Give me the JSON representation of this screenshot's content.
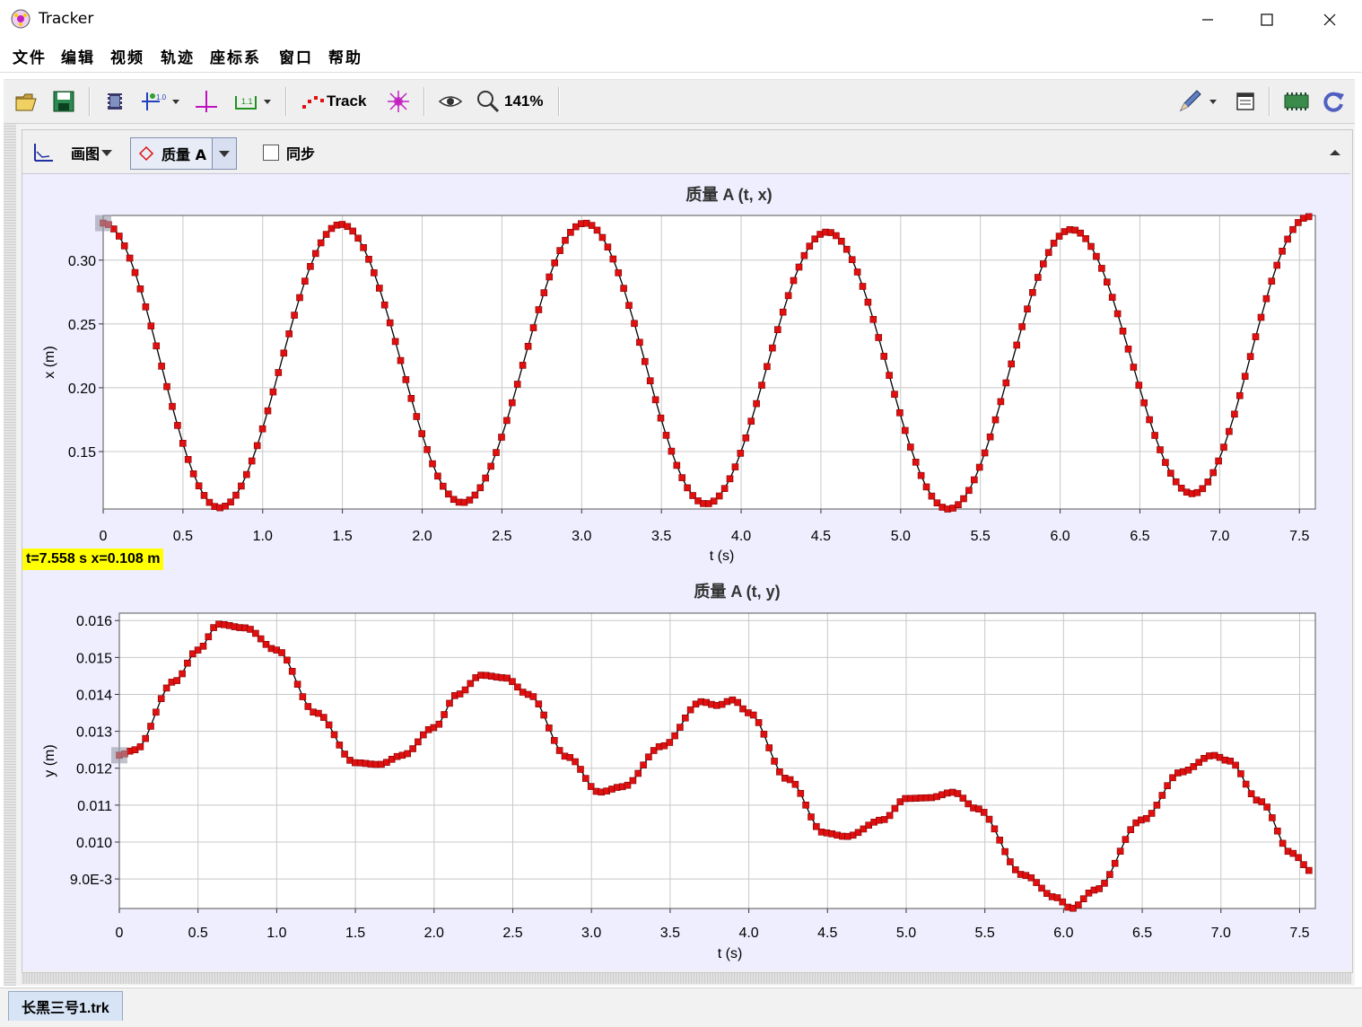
{
  "window": {
    "title": "Tracker"
  },
  "menu": [
    "文件",
    "编辑",
    "视频",
    "轨迹",
    "座标系",
    "窗口",
    "帮助"
  ],
  "toolbar": {
    "track_label": "Track",
    "zoom_label": "141%"
  },
  "plot_toolbar": {
    "plot_label": "画图",
    "track_select": "质量 A",
    "sync_label": "同步"
  },
  "readout": "t=7.558 s  x=0.108 m",
  "tab": {
    "label": "长黑三号1.trk"
  },
  "icons": [
    "open-folder-icon",
    "save-icon",
    "video-clip-icon",
    "calibration-icon",
    "axes-icon",
    "tape-measure-icon",
    "track-icon",
    "particle-model-icon",
    "eye-icon",
    "zoom-icon",
    "pencil-icon",
    "notes-icon",
    "memory-icon",
    "refresh-icon"
  ],
  "colors": {
    "marker": "#e01010",
    "line": "#000000",
    "highlight": "#ffff00",
    "plot_bg": "#eeeeff"
  },
  "chart_data": [
    {
      "type": "line",
      "title": "质量 A (t, x)",
      "xlabel": "t (s)",
      "ylabel": "x (m)",
      "xlim": [
        0,
        7.6
      ],
      "ylim": [
        0.105,
        0.335
      ],
      "xticks": [
        "0",
        "0.5",
        "1.0",
        "1.5",
        "2.0",
        "2.5",
        "3.0",
        "3.5",
        "4.0",
        "4.5",
        "5.0",
        "5.5",
        "6.0",
        "6.5",
        "7.0",
        "7.5"
      ],
      "yticks": [
        "0.15",
        "0.20",
        "0.25",
        "0.30"
      ],
      "grid": true,
      "dt": 0.0333,
      "extrema": [
        {
          "t": 0.0,
          "x": 0.329
        },
        {
          "t": 0.73,
          "x": 0.106
        },
        {
          "t": 1.49,
          "x": 0.328
        },
        {
          "t": 2.25,
          "x": 0.11
        },
        {
          "t": 3.02,
          "x": 0.329
        },
        {
          "t": 3.78,
          "x": 0.109
        },
        {
          "t": 4.54,
          "x": 0.322
        },
        {
          "t": 5.3,
          "x": 0.105
        },
        {
          "t": 6.07,
          "x": 0.324
        },
        {
          "t": 6.83,
          "x": 0.117
        },
        {
          "t": 7.56,
          "x": 0.334
        }
      ]
    },
    {
      "type": "line",
      "title": "质量 A (t, y)",
      "xlabel": "t (s)",
      "ylabel": "y (m)",
      "xlim": [
        0,
        7.6
      ],
      "ylim": [
        0.0082,
        0.0162
      ],
      "xticks": [
        "0",
        "0.5",
        "1.0",
        "1.5",
        "2.0",
        "2.5",
        "3.0",
        "3.5",
        "4.0",
        "4.5",
        "5.0",
        "5.5",
        "6.0",
        "6.5",
        "7.0",
        "7.5"
      ],
      "yticks": [
        "9.0E-3",
        "0.010",
        "0.011",
        "0.012",
        "0.013",
        "0.014",
        "0.015",
        "0.016"
      ],
      "grid": true,
      "dt": 0.0333,
      "keypoints": [
        {
          "t": 0.0,
          "y": 0.01235
        },
        {
          "t": 0.1,
          "y": 0.0125
        },
        {
          "t": 0.35,
          "y": 0.01435
        },
        {
          "t": 0.5,
          "y": 0.0152
        },
        {
          "t": 0.63,
          "y": 0.0159
        },
        {
          "t": 0.8,
          "y": 0.0158
        },
        {
          "t": 1.0,
          "y": 0.0152
        },
        {
          "t": 1.25,
          "y": 0.0135
        },
        {
          "t": 1.5,
          "y": 0.01215
        },
        {
          "t": 1.65,
          "y": 0.0121
        },
        {
          "t": 1.8,
          "y": 0.01235
        },
        {
          "t": 2.0,
          "y": 0.0131
        },
        {
          "t": 2.15,
          "y": 0.014
        },
        {
          "t": 2.3,
          "y": 0.01452
        },
        {
          "t": 2.45,
          "y": 0.01445
        },
        {
          "t": 2.6,
          "y": 0.014
        },
        {
          "t": 2.85,
          "y": 0.0123
        },
        {
          "t": 3.05,
          "y": 0.01135
        },
        {
          "t": 3.2,
          "y": 0.0115
        },
        {
          "t": 3.45,
          "y": 0.0126
        },
        {
          "t": 3.7,
          "y": 0.0138
        },
        {
          "t": 3.8,
          "y": 0.0137
        },
        {
          "t": 3.9,
          "y": 0.01385
        },
        {
          "t": 4.0,
          "y": 0.0135
        },
        {
          "t": 4.25,
          "y": 0.0117
        },
        {
          "t": 4.48,
          "y": 0.01025
        },
        {
          "t": 4.62,
          "y": 0.01015
        },
        {
          "t": 4.85,
          "y": 0.0106
        },
        {
          "t": 5.0,
          "y": 0.01118
        },
        {
          "t": 5.15,
          "y": 0.0112
        },
        {
          "t": 5.3,
          "y": 0.01135
        },
        {
          "t": 5.45,
          "y": 0.0109
        },
        {
          "t": 5.75,
          "y": 0.0091
        },
        {
          "t": 5.95,
          "y": 0.0085
        },
        {
          "t": 6.05,
          "y": 0.0082
        },
        {
          "t": 6.2,
          "y": 0.0087
        },
        {
          "t": 6.5,
          "y": 0.0106
        },
        {
          "t": 6.75,
          "y": 0.0119
        },
        {
          "t": 6.95,
          "y": 0.01235
        },
        {
          "t": 7.05,
          "y": 0.0122
        },
        {
          "t": 7.25,
          "y": 0.0111
        },
        {
          "t": 7.45,
          "y": 0.0097
        },
        {
          "t": 7.58,
          "y": 0.0092
        }
      ]
    }
  ]
}
